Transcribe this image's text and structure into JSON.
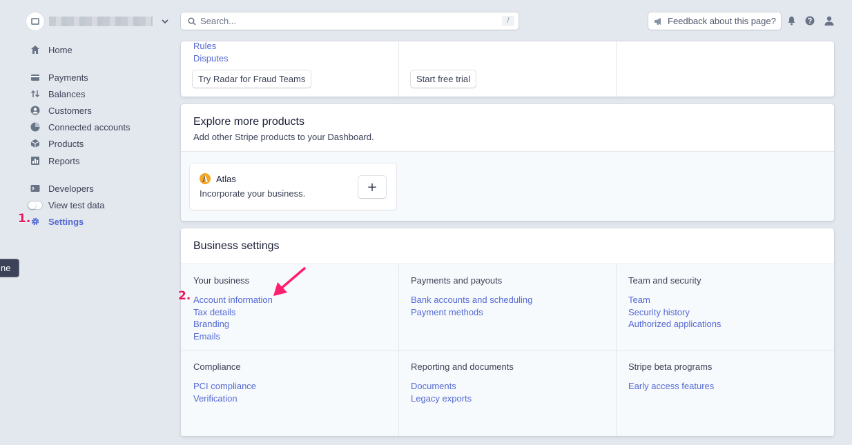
{
  "sidebar": {
    "nav": [
      {
        "label": "Home",
        "icon": "home-icon"
      },
      {
        "label": "Payments",
        "icon": "payments-icon"
      },
      {
        "label": "Balances",
        "icon": "balances-icon"
      },
      {
        "label": "Customers",
        "icon": "customers-icon"
      },
      {
        "label": "Connected accounts",
        "icon": "connected-accounts-icon"
      },
      {
        "label": "Products",
        "icon": "products-icon"
      },
      {
        "label": "Reports",
        "icon": "reports-icon"
      },
      {
        "label": "Developers",
        "icon": "developers-icon"
      },
      {
        "label": "View test data",
        "icon": "toggle"
      },
      {
        "label": "Settings",
        "icon": "gear-icon"
      }
    ],
    "tooltip_fragment": "ne"
  },
  "annotations": {
    "step1": "1.",
    "step2": "2."
  },
  "topbar": {
    "search_placeholder": "Search...",
    "search_shortcut": "/",
    "feedback_label": "Feedback about this page?"
  },
  "radar_card": {
    "links": [
      "Rules",
      "Disputes"
    ],
    "button1": "Try Radar for Fraud Teams",
    "button2": "Start free trial"
  },
  "explore": {
    "title": "Explore more products",
    "subtitle": "Add other Stripe products to your Dashboard.",
    "product": {
      "name": "Atlas",
      "desc": "Incorporate your business.",
      "add_label": "+"
    }
  },
  "business_settings": {
    "title": "Business settings",
    "sections": [
      {
        "heading": "Your business",
        "links": [
          "Account information",
          "Tax details",
          "Branding",
          "Emails"
        ]
      },
      {
        "heading": "Payments and payouts",
        "links": [
          "Bank accounts and scheduling",
          "Payment methods"
        ]
      },
      {
        "heading": "Team and security",
        "links": [
          "Team",
          "Security history",
          "Authorized applications"
        ]
      },
      {
        "heading": "Compliance",
        "links": [
          "PCI compliance",
          "Verification"
        ]
      },
      {
        "heading": "Reporting and documents",
        "links": [
          "Documents",
          "Legacy exports"
        ]
      },
      {
        "heading": "Stripe beta programs",
        "links": [
          "Early access features"
        ]
      }
    ]
  },
  "colors": {
    "accent": "#5469d4",
    "annotation": "#e8175d",
    "background": "#e3e8ee"
  }
}
